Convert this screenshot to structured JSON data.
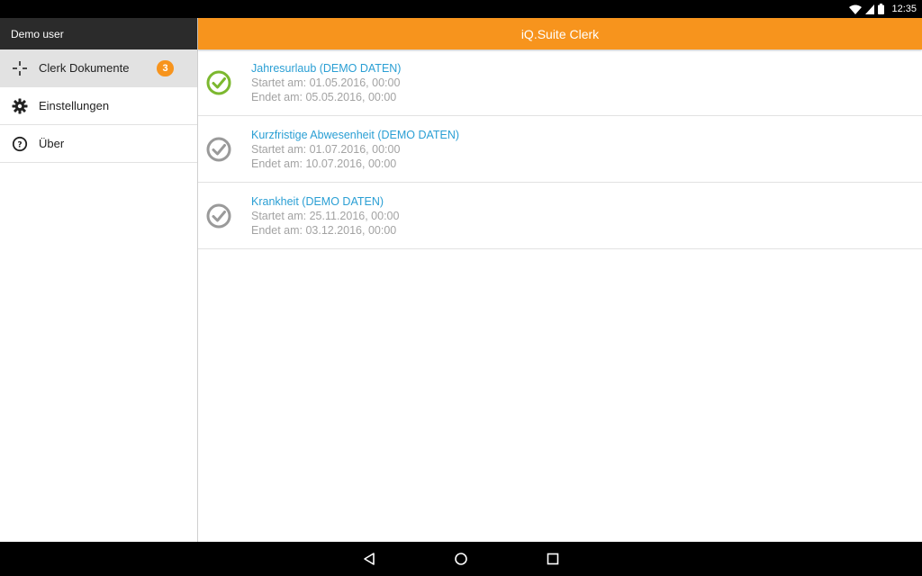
{
  "status_bar": {
    "time": "12:35",
    "icons": [
      "wifi-icon",
      "signal-icon",
      "battery-icon"
    ]
  },
  "sidebar": {
    "user": "Demo user",
    "items": [
      {
        "label": "Clerk Dokumente",
        "icon": "move-arrows-icon",
        "badge": "3",
        "active": true
      },
      {
        "label": "Einstellungen",
        "icon": "gear-icon"
      },
      {
        "label": "Über",
        "icon": "help-icon"
      }
    ]
  },
  "app_bar": {
    "title": "iQ.Suite Clerk"
  },
  "documents": [
    {
      "title": "Jahresurlaub (DEMO DATEN)",
      "start": "Startet am: 01.05.2016, 00:00",
      "end": "Endet am: 05.05.2016, 00:00",
      "status": "approved"
    },
    {
      "title": "Kurzfristige Abwesenheit (DEMO DATEN)",
      "start": "Startet am: 01.07.2016, 00:00",
      "end": "Endet am: 10.07.2016, 00:00",
      "status": "pending"
    },
    {
      "title": "Krankheit (DEMO DATEN)",
      "start": "Startet am: 25.11.2016, 00:00",
      "end": "Endet am: 03.12.2016, 00:00",
      "status": "pending"
    }
  ],
  "colors": {
    "accent": "#f7941d",
    "link": "#2a9fd4",
    "approved": "#7cb82f",
    "pending": "#9a9a9a"
  },
  "nav_bar": {
    "buttons": [
      "back-icon",
      "home-icon",
      "recents-icon"
    ]
  }
}
